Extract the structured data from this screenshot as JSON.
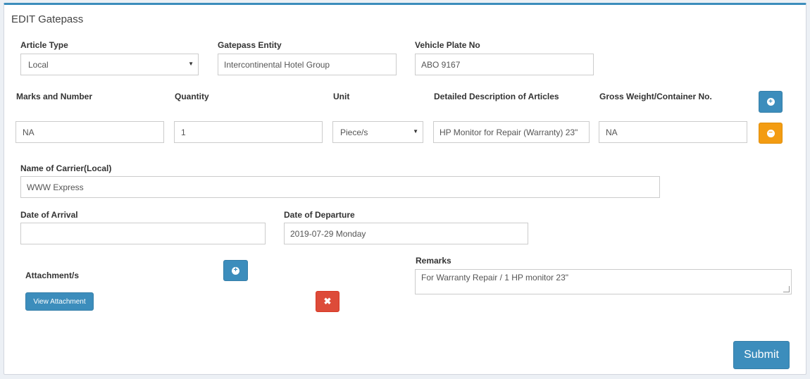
{
  "panel": {
    "title": "EDIT Gatepass"
  },
  "article_type": {
    "label": "Article Type",
    "value": "Local"
  },
  "gatepass_entity": {
    "label": "Gatepass Entity",
    "value": "Intercontinental Hotel Group"
  },
  "vehicle_plate": {
    "label": "Vehicle Plate No",
    "value": "ABO 9167"
  },
  "items_table": {
    "headers": {
      "marks": "Marks and Number",
      "quantity": "Quantity",
      "unit": "Unit",
      "description": "Detailed Description of Articles",
      "gross_weight": "Gross Weight/Container No."
    },
    "rows": [
      {
        "marks": "NA",
        "quantity": "1",
        "unit": "Piece/s",
        "description": "HP Monitor for Repair (Warranty) 23\"",
        "gross_weight": "NA"
      }
    ]
  },
  "carrier": {
    "label": "Name of Carrier(Local)",
    "value": "WWW Express"
  },
  "arrival": {
    "label": "Date of Arrival",
    "value": ""
  },
  "departure": {
    "label": "Date of Departure",
    "value": "2019-07-29 Monday"
  },
  "attachments": {
    "label": "Attachment/s",
    "view_label": "View Attachment"
  },
  "remarks": {
    "label": "Remarks",
    "value": "For Warranty Repair / 1 HP monitor 23\""
  },
  "submit_label": "Submit",
  "icons": {
    "add": "plus-circle-icon",
    "remove": "minus-circle-icon",
    "delete": "times-icon"
  },
  "colors": {
    "primary": "#3c8dbc",
    "warning": "#f39c12",
    "danger": "#dd4b39"
  }
}
